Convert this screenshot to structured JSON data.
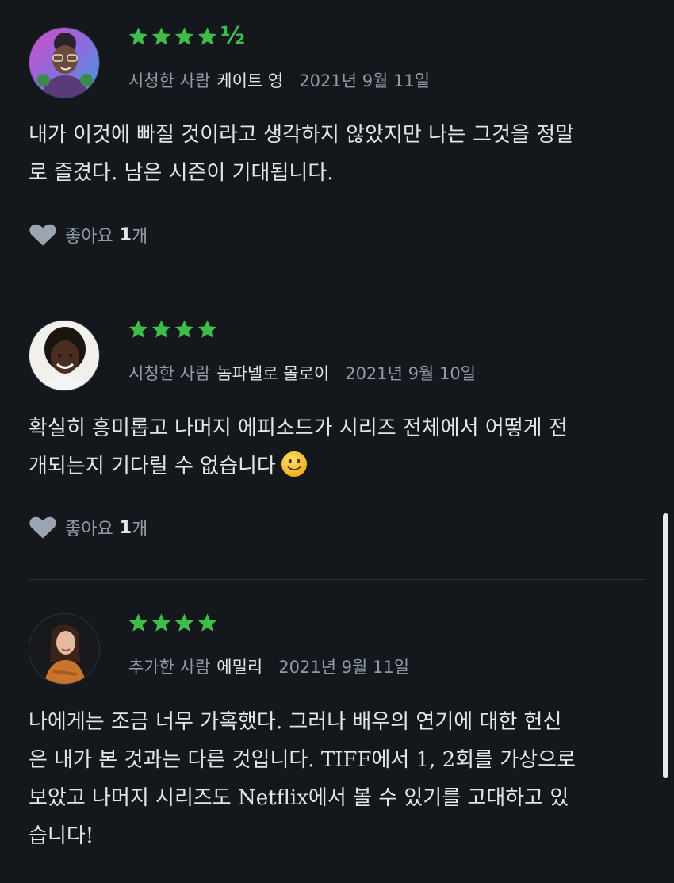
{
  "reviews": [
    {
      "rating_half": "½",
      "verb": "시청한 사람",
      "reviewer": "케이트 영",
      "date": "2021년 9월 11일",
      "line1": "내가 이것에 빠질 것이라고 생각하지 않았지만 나는 그것을 정말",
      "line2": "로 즐겼다. 남은 시즌이 기대됩니다.",
      "likes_label": "좋아요",
      "likes_count": "1",
      "likes_unit": "개"
    },
    {
      "verb": "시청한 사람",
      "reviewer": "놈파넬로 몰로이",
      "date": "2021년 9월 10일",
      "line1": "확실히 흥미롭고 나머지 에피소드가 시리즈 전체에서 어떻게 전",
      "line2": "개되는지 기다릴 수 없습니다",
      "likes_label": "좋아요",
      "likes_count": "1",
      "likes_unit": "개"
    },
    {
      "verb": "추가한 사람",
      "reviewer": "에밀리",
      "date": "2021년 9월 11일",
      "line1": "나에게는 조금 너무 가혹했다. 그러나 배우의 연기에 대한 헌신",
      "line2": "은 내가 본 것과는 다른 것입니다. TIFF에서 1, 2회를 가상으로",
      "line3": "보았고 나머지 시리즈도 Netflix에서 볼 수 있기를 고대하고 있",
      "line4": "습니다!"
    }
  ],
  "ratings": [
    4.5,
    4,
    4
  ],
  "icons": {
    "star": "star-icon",
    "heart": "heart-icon",
    "emoji": "slightly-smiling-face-emoji"
  },
  "colors": {
    "background": "#14181c",
    "star": "#40bc4a",
    "meta": "#8f9ba8",
    "text": "#e2e5e9"
  }
}
